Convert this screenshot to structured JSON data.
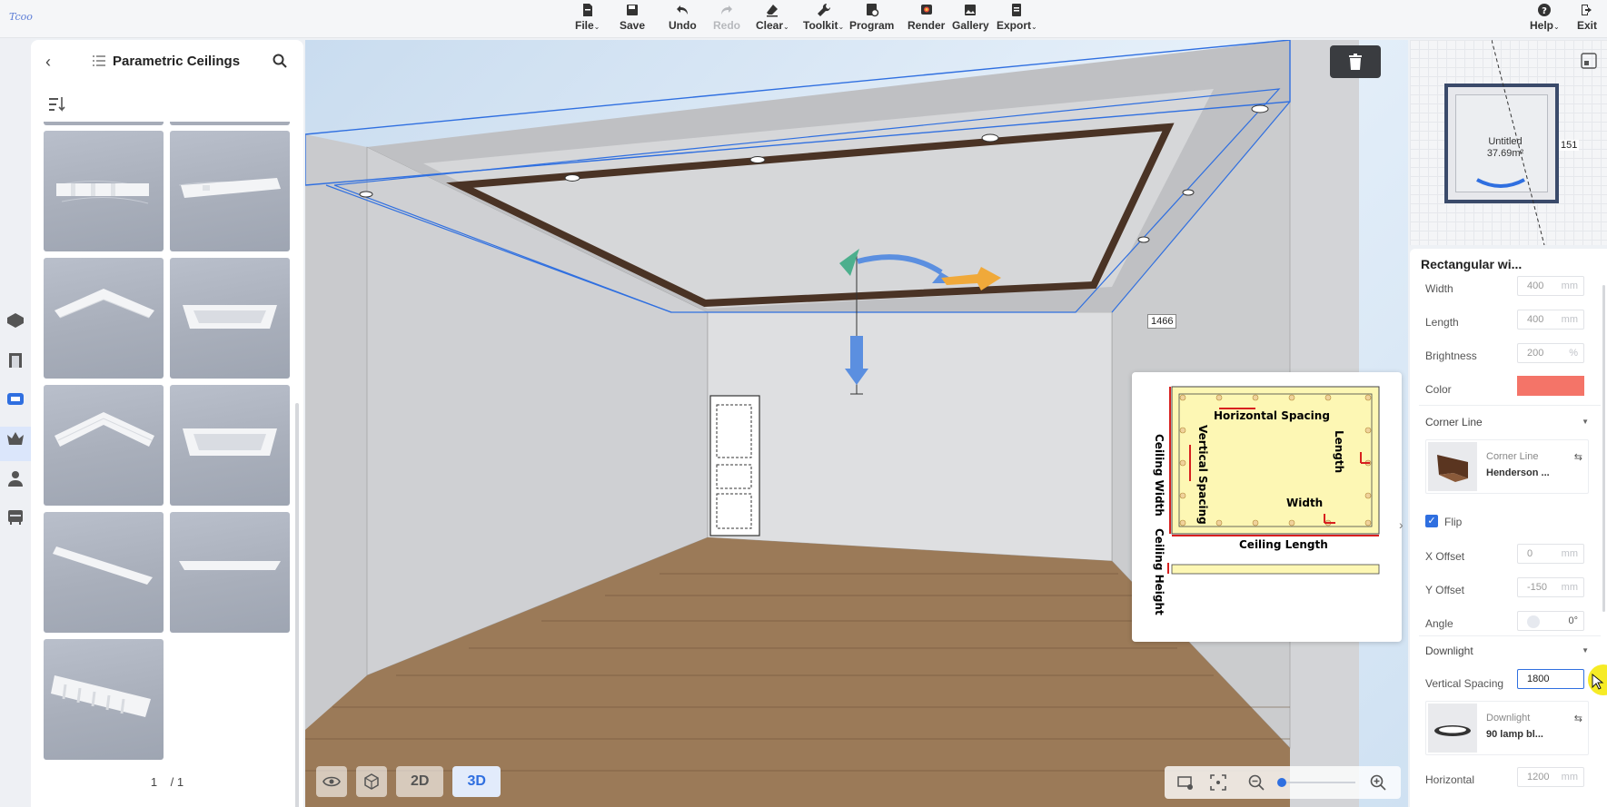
{
  "toolbar": {
    "file": "File",
    "save": "Save",
    "undo": "Undo",
    "redo": "Redo",
    "clear": "Clear",
    "toolkit": "Toolkit",
    "program": "Program",
    "render": "Render",
    "gallery": "Gallery",
    "export": "Export",
    "help": "Help",
    "exit": "Exit",
    "caret": "⌄"
  },
  "left_panel": {
    "title": "Parametric Ceilings",
    "pager_current": "1",
    "pager_total": "/ 1"
  },
  "viewport": {
    "dimension_label": "1466",
    "tab_2d": "2D",
    "tab_3d": "3D"
  },
  "diagram": {
    "horizontal_spacing": "Horizontal Spacing",
    "vertical_spacing": "Vertical Spacing",
    "length": "Length",
    "width": "Width",
    "ceiling_width": "Ceiling Width",
    "ceiling_length": "Ceiling Length",
    "ceiling_height": "Ceiling Height"
  },
  "minimap": {
    "room_name": "Untitled",
    "room_area": "37.69m²",
    "dimension": "151"
  },
  "right_panel": {
    "title": "Rectangular wi...",
    "width_label": "Width",
    "width_value": "400",
    "length_label": "Length",
    "length_value": "400",
    "brightness_label": "Brightness",
    "brightness_value": "200",
    "color_label": "Color",
    "color_value": "#f47468",
    "unit_mm": "mm",
    "unit_pct": "%",
    "corner_line_section": "Corner Line",
    "corner_line_kind": "Corner Line",
    "corner_line_name": "Henderson ...",
    "flip_label": "Flip",
    "x_offset_label": "X Offset",
    "x_offset_value": "0",
    "y_offset_label": "Y Offset",
    "y_offset_value": "-150",
    "angle_label": "Angle",
    "angle_value": "0°",
    "downlight_section": "Downlight",
    "vertical_spacing_label": "Vertical Spacing",
    "vertical_spacing_value": "1800",
    "downlight_kind": "Downlight",
    "downlight_name": "90 lamp bl...",
    "horizontal_label": "Horizontal",
    "horizontal_value": "1200"
  },
  "colors": {
    "accent": "#2f6fe0",
    "selection": "#2f6fe0",
    "highlight": "#f5e700"
  }
}
